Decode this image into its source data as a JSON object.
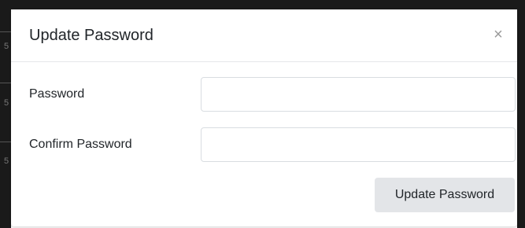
{
  "modal": {
    "title": "Update Password",
    "close_label": "×",
    "fields": [
      {
        "label": "Password",
        "value": "",
        "placeholder": ""
      },
      {
        "label": "Confirm Password",
        "value": "",
        "placeholder": ""
      }
    ],
    "submit_label": "Update Password"
  },
  "background": {
    "row_glyphs": [
      "5",
      "5",
      "5"
    ]
  }
}
